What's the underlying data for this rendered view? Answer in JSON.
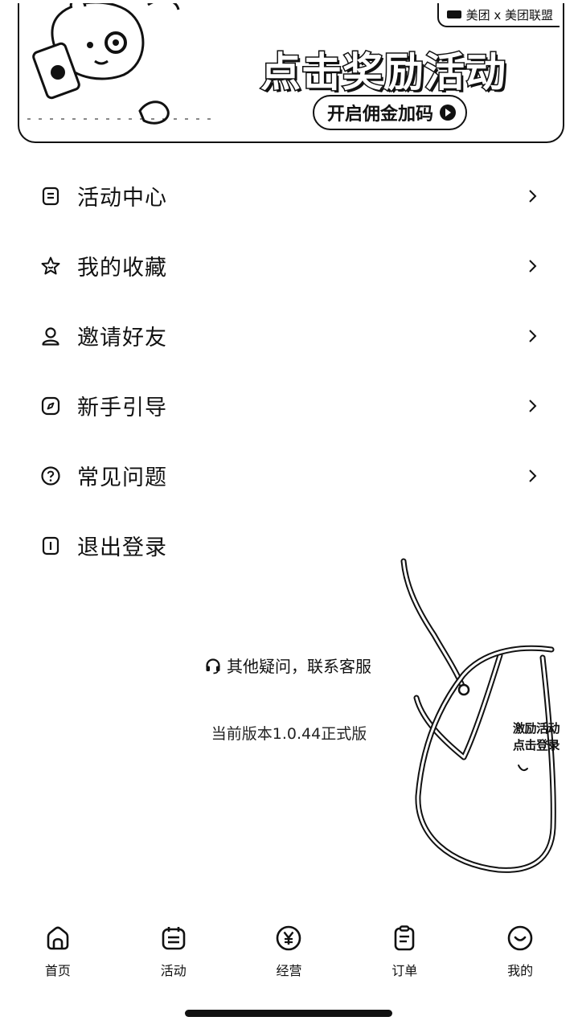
{
  "banner": {
    "brand_text": "美团 x 美团联盟",
    "title": "点击奖励活动",
    "cta_label": "开启佣金加码"
  },
  "menu": {
    "items": [
      {
        "label": "活动中心",
        "icon": "calendar-doc-icon",
        "has_chevron": true
      },
      {
        "label": "我的收藏",
        "icon": "star-icon",
        "has_chevron": true
      },
      {
        "label": "邀请好友",
        "icon": "person-icon",
        "has_chevron": true
      },
      {
        "label": "新手引导",
        "icon": "compass-icon",
        "has_chevron": true
      },
      {
        "label": "常见问题",
        "icon": "question-circle-icon",
        "has_chevron": true
      },
      {
        "label": "退出登录",
        "icon": "logout-icon",
        "has_chevron": false
      }
    ]
  },
  "support": {
    "label": "其他疑问，联系客服",
    "icon": "headset-icon"
  },
  "version": {
    "label": "当前版本1.0.44正式版"
  },
  "floating_promo": {
    "line1": "激励活动",
    "line2": "点击登录"
  },
  "tabbar": {
    "tabs": [
      {
        "label": "首页",
        "icon": "home-icon",
        "active": false
      },
      {
        "label": "活动",
        "icon": "calendar-icon",
        "active": false
      },
      {
        "label": "经营",
        "icon": "yen-circle-icon",
        "active": false
      },
      {
        "label": "订单",
        "icon": "clipboard-icon",
        "active": false
      },
      {
        "label": "我的",
        "icon": "smile-icon",
        "active": true
      }
    ]
  }
}
